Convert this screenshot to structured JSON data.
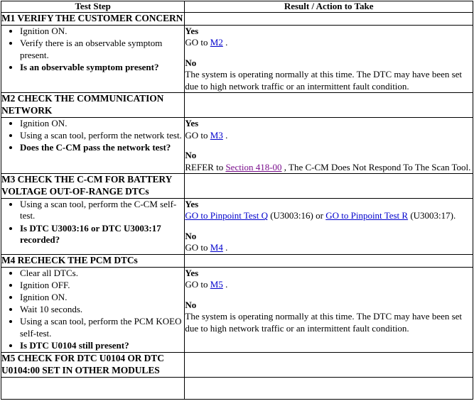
{
  "table": {
    "headers": {
      "test_step": "Test Step",
      "result_action": "Result / Action to Take"
    },
    "link_colors": {
      "unvisited": "#0000cc",
      "visited": "#7a0f8c"
    },
    "steps": [
      {
        "id": "m1",
        "title": "M1 VERIFY THE CUSTOMER CONCERN",
        "bullets": [
          "Ignition ON.",
          "Verify there is an observable symptom present.",
          "Is an observable symptom present?"
        ],
        "question_index": 2,
        "result": {
          "yes_label": "Yes",
          "yes_prefix": "GO to ",
          "yes_link": "M2",
          "yes_suffix": " .",
          "no_label": "No",
          "no_text": "The system is operating normally at this time. The DTC may have been set due to high network traffic or an intermittent fault condition."
        }
      },
      {
        "id": "m2",
        "title": "M2 CHECK THE COMMUNICATION NETWORK",
        "bullets": [
          "Ignition ON.",
          "Using a scan tool, perform the network test.",
          "Does the C-CM pass the network test?"
        ],
        "question_index": 2,
        "result": {
          "yes_label": "Yes",
          "yes_prefix": "GO to ",
          "yes_link": "M3",
          "yes_suffix": " .",
          "no_label": "No",
          "no_prefix": "REFER to ",
          "no_link": "Section 418-00",
          "no_suffix": " , The C-CM Does Not Respond To The Scan Tool."
        }
      },
      {
        "id": "m3",
        "title": "M3 CHECK THE C-CM FOR BATTERY VOLTAGE OUT-OF-RANGE DTCs",
        "bullets": [
          "Using a scan tool, perform the C-CM self-test.",
          "Is DTC U3003:16 or DTC U3003:17 recorded?"
        ],
        "question_index": 1,
        "result": {
          "yes_label": "Yes",
          "yes_link_q": "GO to Pinpoint Test Q",
          "yes_mid_q": " (U3003:16) or ",
          "yes_link_r": "GO to Pinpoint Test R",
          "yes_mid_r": " (U3003:17).",
          "no_label": "No",
          "no_prefix": "GO to ",
          "no_link": "M4",
          "no_suffix": " ."
        }
      },
      {
        "id": "m4",
        "title": "M4 RECHECK THE PCM DTCs",
        "bullets": [
          "Clear all DTCs.",
          "Ignition OFF.",
          "Ignition ON.",
          "Wait 10 seconds.",
          "Using a scan tool, perform the PCM KOEO self-test.",
          "Is DTC U0104 still present?"
        ],
        "question_index": 5,
        "result": {
          "yes_label": "Yes",
          "yes_prefix": "GO to ",
          "yes_link": "M5",
          "yes_suffix": " .",
          "no_label": "No",
          "no_text": "The system is operating normally at this time. The DTC may have been set due to high network traffic or an intermittent fault condition."
        }
      },
      {
        "id": "m5",
        "title": "M5 CHECK FOR DTC U0104 OR DTC U0104:00 SET IN OTHER MODULES"
      }
    ]
  }
}
